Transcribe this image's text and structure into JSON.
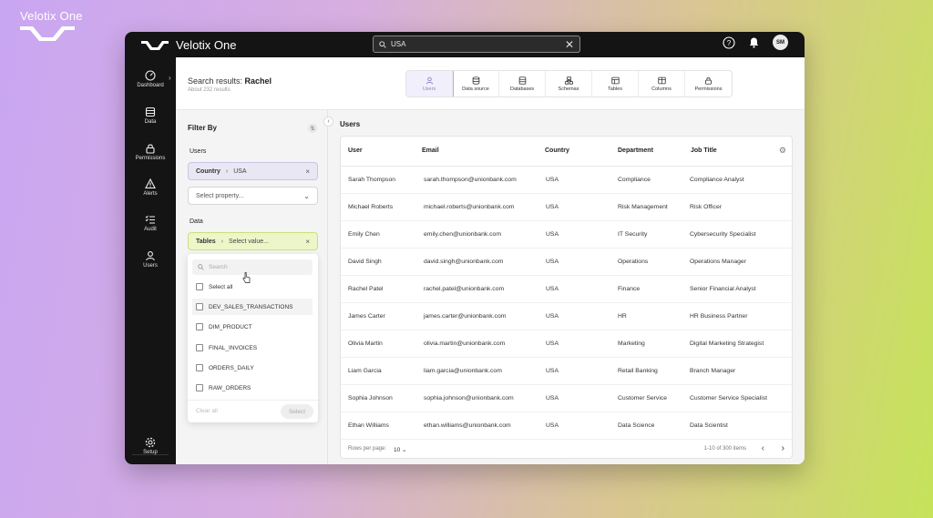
{
  "corner_brand": "Velotix One",
  "app": {
    "name": "Velotix One"
  },
  "topbar": {
    "search_value": "USA",
    "clear_icon": "close-icon",
    "help_icon": "help-icon",
    "bell_icon": "bell-icon",
    "avatar_initials": "SM"
  },
  "sidebar": {
    "items": [
      {
        "label": "Dashboard",
        "icon": "gauge-icon"
      },
      {
        "label": "Data",
        "icon": "database-icon"
      },
      {
        "label": "Permissions",
        "icon": "lock-icon"
      },
      {
        "label": "Alerts",
        "icon": "alert-icon"
      },
      {
        "label": "Audit",
        "icon": "checklist-icon"
      },
      {
        "label": "Users",
        "icon": "user-icon"
      },
      {
        "label": "Setup",
        "icon": "gear-icon"
      }
    ]
  },
  "header": {
    "title_prefix": "Search results:",
    "title_query": "Rachel",
    "subtitle": "About 232 results"
  },
  "tabs": [
    {
      "label": "Users",
      "icon": "user-icon",
      "active": true
    },
    {
      "label": "Data source",
      "icon": "database-icon",
      "active": false
    },
    {
      "label": "Databases",
      "icon": "database-icon",
      "active": false
    },
    {
      "label": "Schemas",
      "icon": "schema-icon",
      "active": false
    },
    {
      "label": "Tables",
      "icon": "table-icon",
      "active": false
    },
    {
      "label": "Columns",
      "icon": "columns-icon",
      "active": false
    },
    {
      "label": "Permissions",
      "icon": "lock-icon",
      "active": false
    }
  ],
  "filter": {
    "title": "Filter By",
    "users_label": "Users",
    "users_chip": {
      "key": "Country",
      "value": "USA"
    },
    "property_placeholder": "Select property...",
    "data_label": "Data",
    "data_chip": {
      "key": "Tables",
      "value": "Select value..."
    },
    "dropdown": {
      "search_placeholder": "Search",
      "items": [
        "Select all",
        "DEV_SALES_TRANSACTIONS",
        "DIM_PRODUCT",
        "FINAL_INVOICES",
        "ORDERS_DAILY",
        "RAW_ORDERS"
      ],
      "clear_label": "Clear all",
      "select_label": "Select"
    }
  },
  "main": {
    "title": "Users",
    "columns": [
      "User",
      "Email",
      "Country",
      "Department",
      "Job Title"
    ],
    "rows": [
      [
        "Sarah Thompson",
        "sarah.thompson@unionbank.com",
        "USA",
        "Compliance",
        "Compliance Analyst"
      ],
      [
        "Michael Roberts",
        "michael.roberts@unionbank.com",
        "USA",
        "Risk Management",
        "Risk Officer"
      ],
      [
        "Emily Chen",
        "emily.chen@unionbank.com",
        "USA",
        "IT Security",
        "Cybersecurity Specialist"
      ],
      [
        "David Singh",
        "david.singh@unionbank.com",
        "USA",
        "Operations",
        "Operations Manager"
      ],
      [
        "Rachel Patel",
        "rachel.patel@unionbank.com",
        "USA",
        "Finance",
        "Senior Financial Analyst"
      ],
      [
        "James Carter",
        "james.carter@unionbank.com",
        "USA",
        "HR",
        "HR Business Partner"
      ],
      [
        "Olivia Martin",
        "olivia.martin@unionbank.com",
        "USA",
        "Marketing",
        "Digital Marketing Strategist"
      ],
      [
        "Liam Garcia",
        "liam.garcia@unionbank.com",
        "USA",
        "Retail Banking",
        "Branch Manager"
      ],
      [
        "Sophia Johnson",
        "sophia.johnson@unionbank.com",
        "USA",
        "Customer Service",
        "Customer Service Specialist"
      ],
      [
        "Ethan Williams",
        "ethan.williams@unionbank.com",
        "USA",
        "Data Science",
        "Data Scientist"
      ]
    ],
    "footer": {
      "rows_per_page_label": "Rows per page:",
      "rows_per_page_value": "10",
      "range": "1-10 of 300 items"
    }
  },
  "colors": {
    "accent_purple": "#8f84c9",
    "accent_green": "#cbe07c",
    "sidebar_bg": "#141414"
  }
}
